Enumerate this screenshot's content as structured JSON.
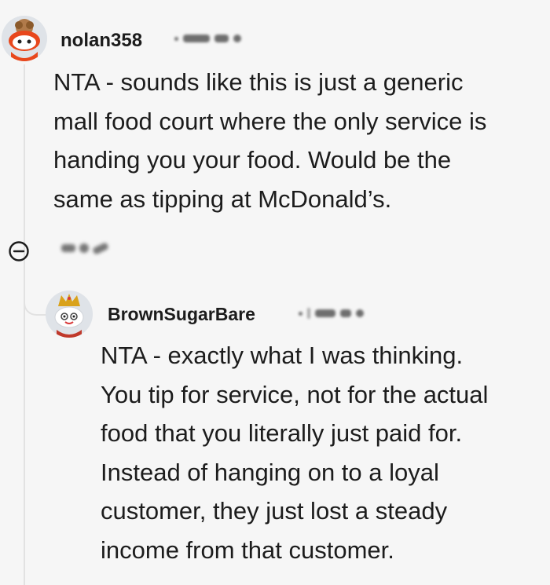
{
  "comments": [
    {
      "username": "nolan358",
      "avatar_icon": "snoo-avatar-icon",
      "body": "NTA - sounds like this is just a generic\nmall food court where the only service is\nhanding you your food. Would be the\nsame as tipping at McDonald’s."
    },
    {
      "username": "BrownSugarBare",
      "avatar_icon": "snoo-crown-avatar-icon",
      "body": "NTA - exactly what I was thinking.\nYou tip for service, not for the actual\nfood that you literally just paid for.\nInstead of hanging on to a loyal\ncustomer, they just lost a steady\nincome from that customer."
    }
  ],
  "collapse_icon": "collapse-minus-icon",
  "colors": {
    "background": "#f6f6f6",
    "text": "#1c1c1c",
    "thread_line": "#e2e2e2"
  }
}
